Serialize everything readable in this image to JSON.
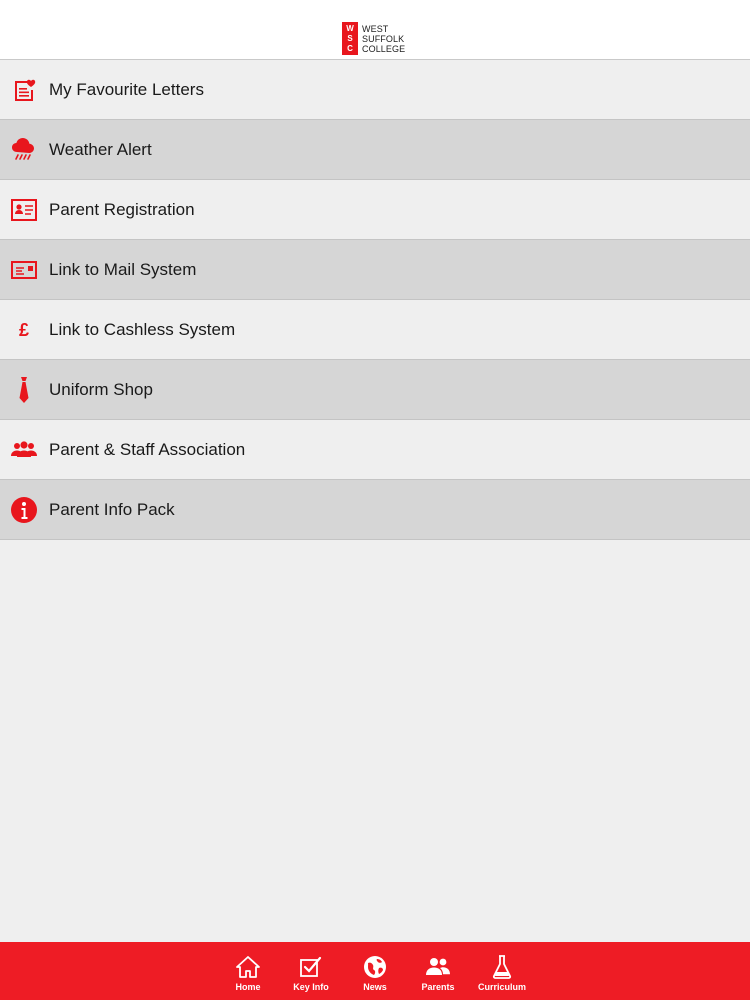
{
  "brand": {
    "logo_letters": [
      "W",
      "S",
      "C"
    ],
    "logo_lines": [
      "WEST",
      "SUFFOLK",
      "COLLEGE"
    ],
    "accent_color": "#e8161d"
  },
  "menu": {
    "items": [
      {
        "label": "My Favourite Letters",
        "icon": "letter-heart-icon"
      },
      {
        "label": "Weather Alert",
        "icon": "cloud-rain-icon"
      },
      {
        "label": "Parent Registration",
        "icon": "id-card-icon"
      },
      {
        "label": "Link to Mail System",
        "icon": "envelope-icon"
      },
      {
        "label": "Link to Cashless System",
        "icon": "pound-icon"
      },
      {
        "label": "Uniform Shop",
        "icon": "tie-icon"
      },
      {
        "label": "Parent & Staff Association",
        "icon": "group-icon"
      },
      {
        "label": "Parent Info Pack",
        "icon": "info-icon"
      }
    ]
  },
  "tabbar": {
    "tabs": [
      {
        "label": "Home",
        "icon": "home-icon"
      },
      {
        "label": "Key Info",
        "icon": "checkbox-icon"
      },
      {
        "label": "News",
        "icon": "globe-icon"
      },
      {
        "label": "Parents",
        "icon": "parents-icon",
        "selected": true
      },
      {
        "label": "Curriculum",
        "icon": "flask-icon"
      }
    ],
    "background_color": "#ee1c25"
  }
}
